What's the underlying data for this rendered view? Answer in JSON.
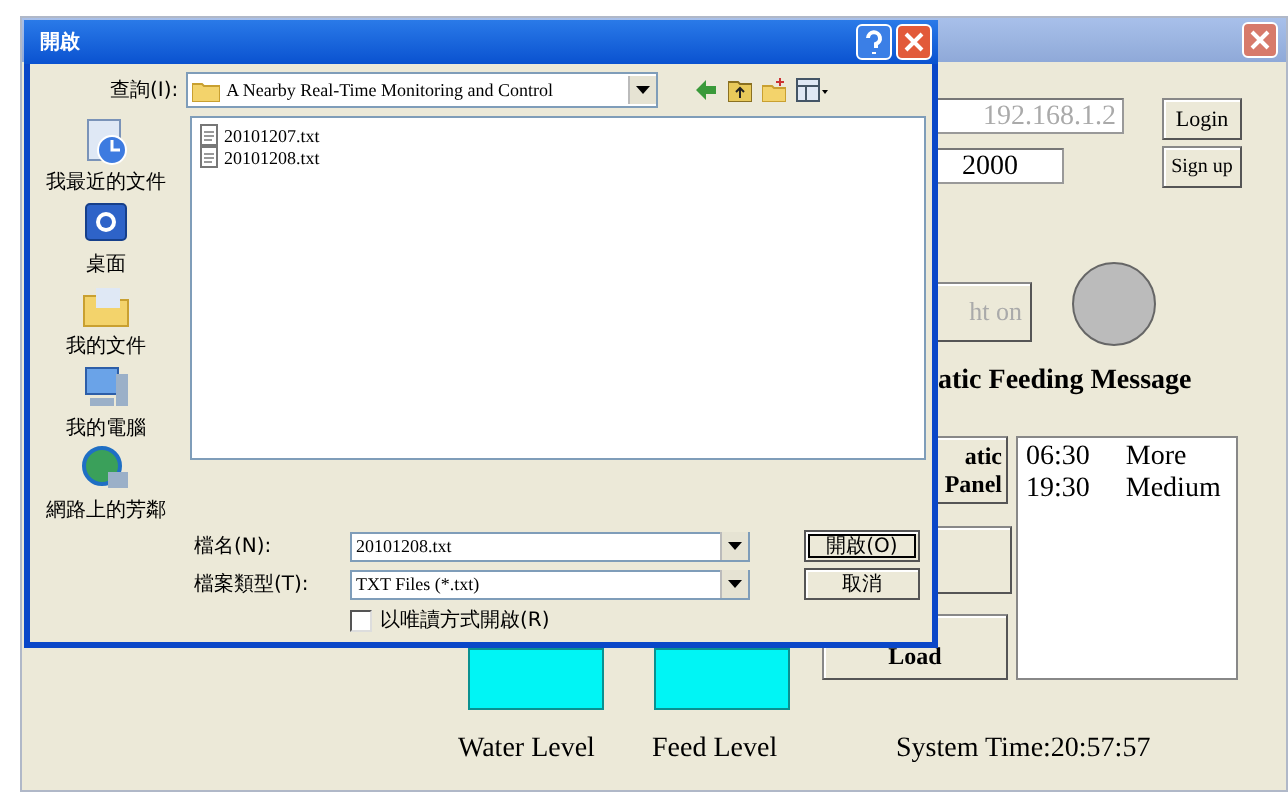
{
  "app": {
    "ip": "192.168.1.2",
    "port": "2000",
    "login": "Login",
    "signup": "Sign up",
    "light_button": "ht on",
    "light_on": false,
    "feeding_title": "atic Feeding Message",
    "panel_button": "atic Panel",
    "load_button": "Load",
    "schedule": [
      {
        "time": "06:30",
        "amount": "More"
      },
      {
        "time": "19:30",
        "amount": "Medium"
      }
    ],
    "water_label": "Water Level",
    "feed_label": "Feed Level",
    "system_time": "System Time:20:57:57"
  },
  "dialog": {
    "title": "開啟",
    "look_in_label": "查詢(I):",
    "look_in": "A Nearby Real-Time Monitoring and Control",
    "places": [
      {
        "label": "我最近的文件",
        "kind": "recent"
      },
      {
        "label": "桌面",
        "kind": "desktop"
      },
      {
        "label": "我的文件",
        "kind": "documents"
      },
      {
        "label": "我的電腦",
        "kind": "computer"
      },
      {
        "label": "網路上的芳鄰",
        "kind": "network"
      }
    ],
    "files": [
      "20101207.txt",
      "20101208.txt"
    ],
    "file_name_label": "檔名(N):",
    "file_name": "20101208.txt",
    "file_type_label": "檔案類型(T):",
    "file_type": "TXT Files (*.txt)",
    "read_only": {
      "label": "以唯讀方式開啟(R)",
      "checked": false
    },
    "buttons": [
      {
        "label": "開啟(O)",
        "default": true
      },
      {
        "label": "取消",
        "default": false
      }
    ]
  }
}
